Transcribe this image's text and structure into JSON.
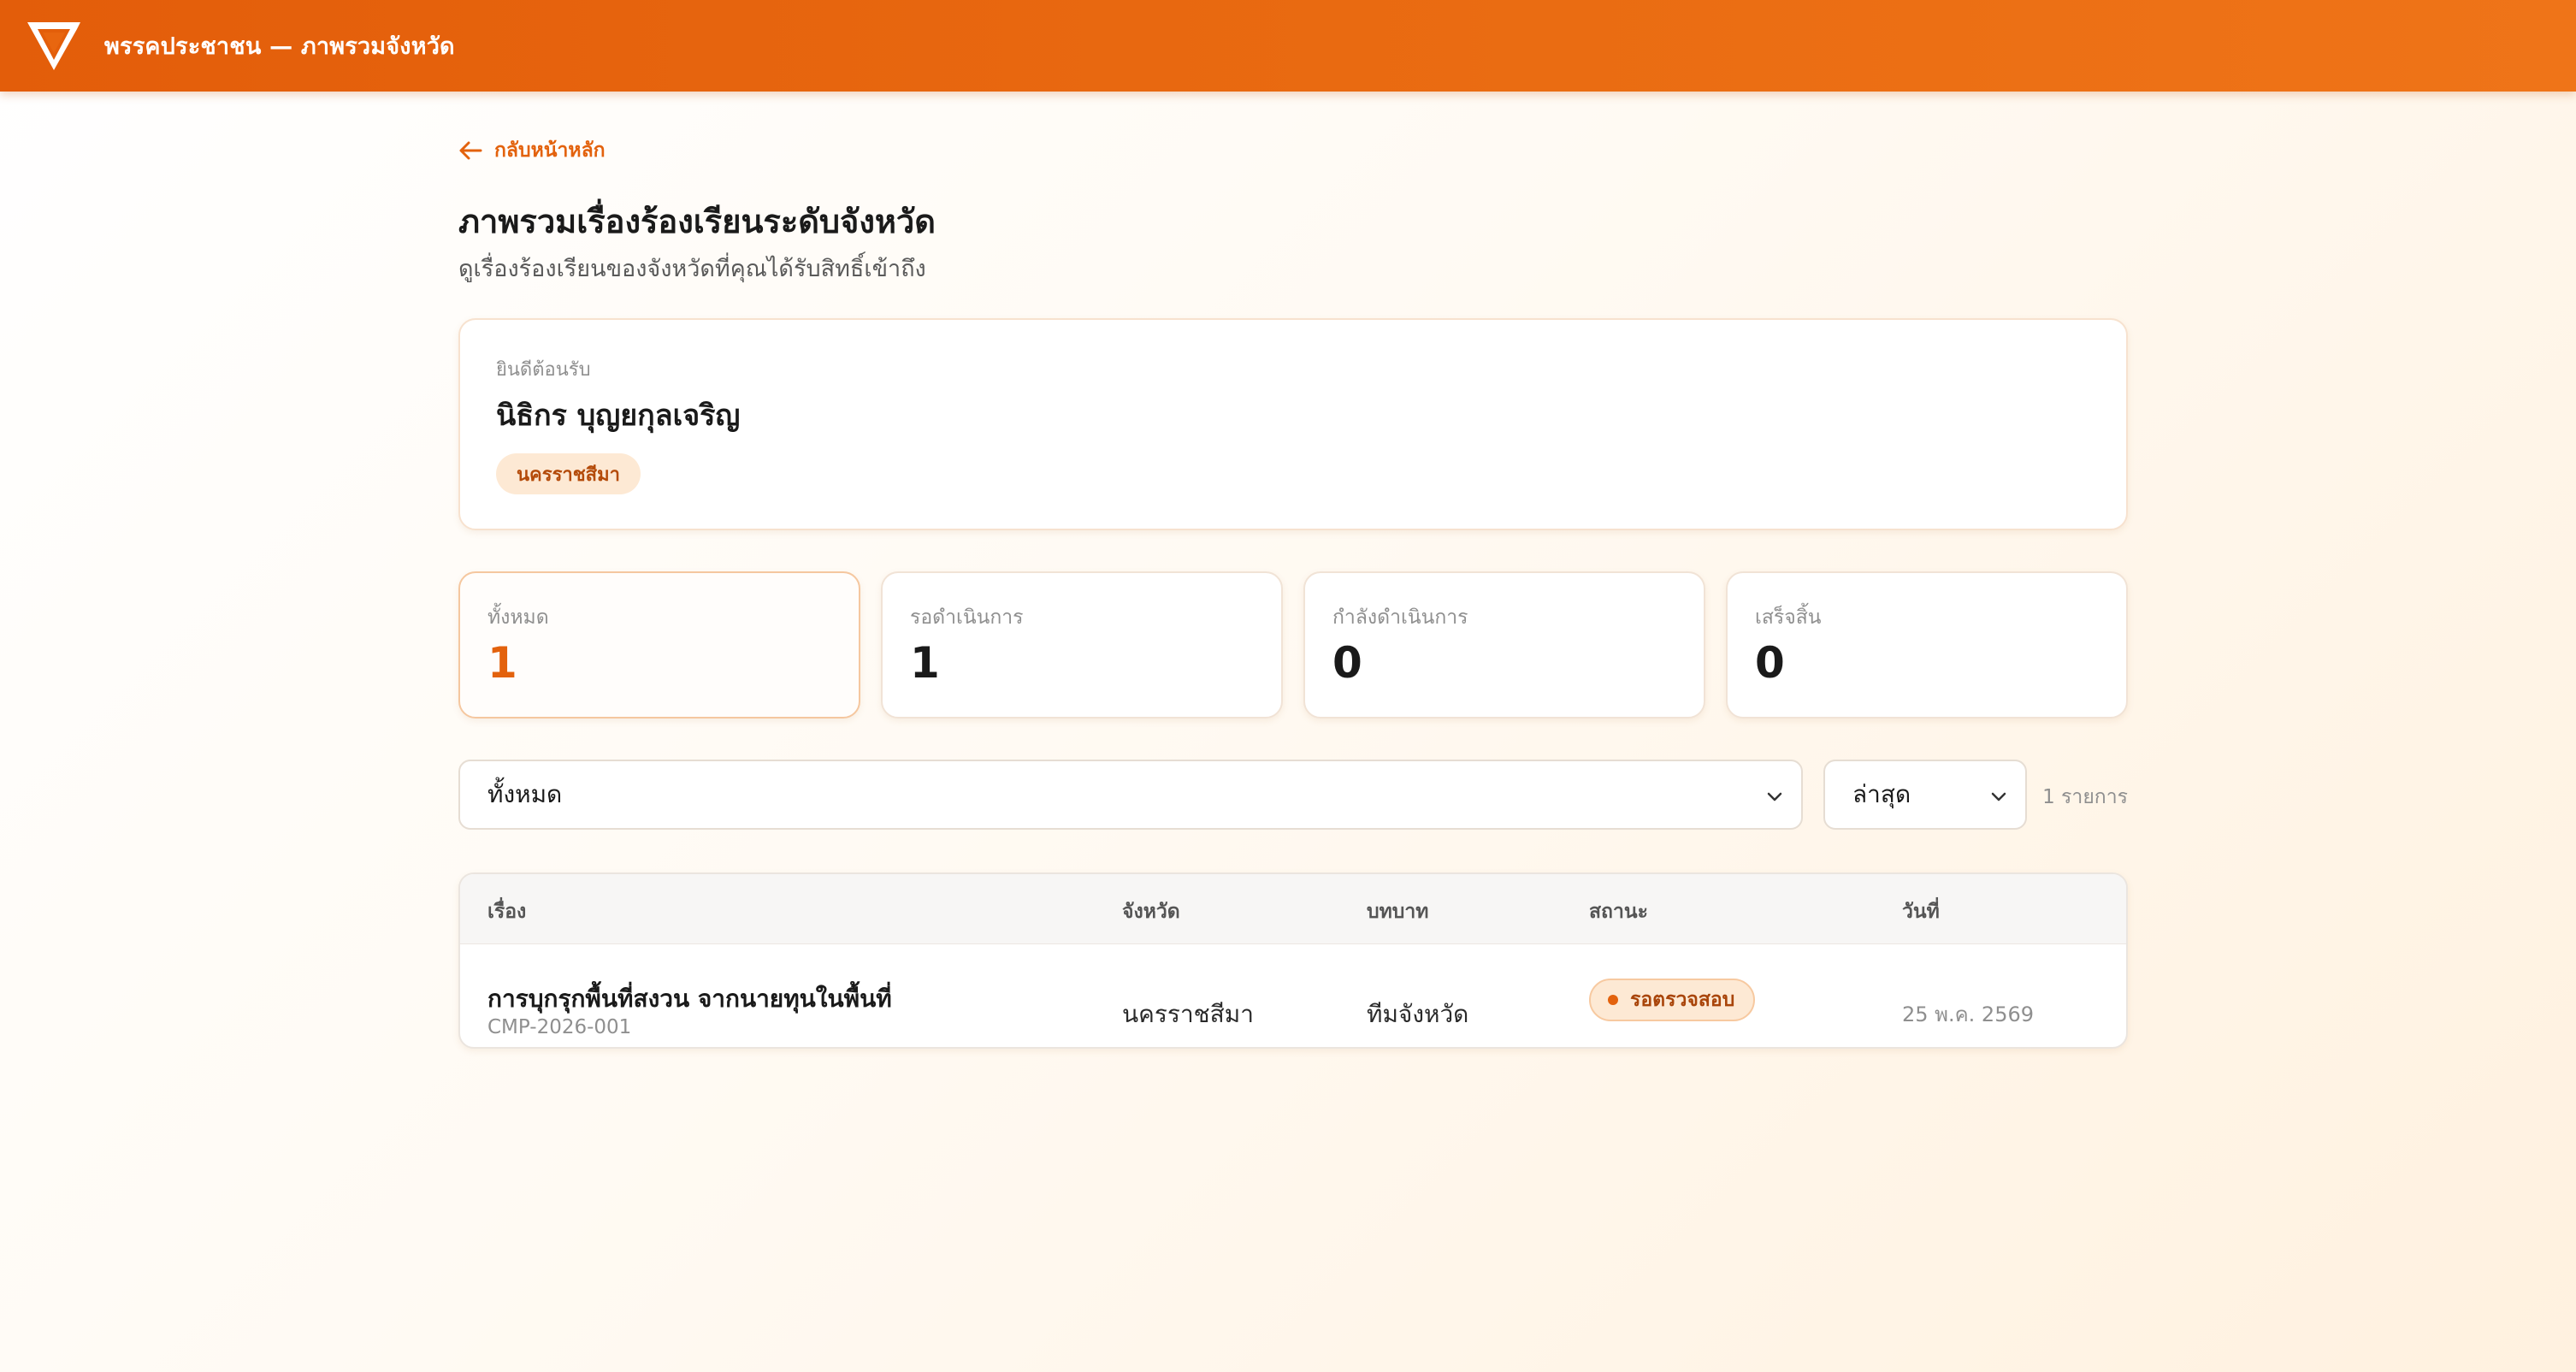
{
  "header": {
    "title": "พรรคประชาชน — ภาพรวมจังหวัด"
  },
  "back_link": {
    "label": "กลับหน้าหลัก"
  },
  "page": {
    "title": "ภาพรวมเรื่องร้องเรียนระดับจังหวัด",
    "subtitle": "ดูเรื่องร้องเรียนของจังหวัดที่คุณได้รับสิทธิ์เข้าถึง"
  },
  "welcome": {
    "label": "ยินดีต้อนรับ",
    "name": "นิธิกร บุญยกุลเจริญ",
    "province": "นครราชสีมา"
  },
  "stats": [
    {
      "label": "ทั้งหมด",
      "value": "1"
    },
    {
      "label": "รอดำเนินการ",
      "value": "1"
    },
    {
      "label": "กำลังดำเนินการ",
      "value": "0"
    },
    {
      "label": "เสร็จสิ้น",
      "value": "0"
    }
  ],
  "filters": {
    "status_value": "ทั้งหมด",
    "sort_value": "ล่าสุด",
    "count": "1 รายการ"
  },
  "table": {
    "headers": [
      "เรื่อง",
      "จังหวัด",
      "บทบาท",
      "สถานะ",
      "วันที่"
    ],
    "rows": [
      {
        "title": "การบุกรุกพื้นที่สงวน จากนายทุนในพื้นที่",
        "id": "CMP-2026-001",
        "province": "นครราชสีมา",
        "role": "ทีมจังหวัด",
        "status": "รอตรวจสอบ",
        "date": "25 พ.ค. 2569"
      }
    ]
  },
  "colors": {
    "brand": "#e3620d",
    "chip_bg": "#fde9d4",
    "chip_text": "#b44b0a"
  },
  "icons": {
    "logo": "party-logo-icon",
    "back": "arrow-left-icon",
    "chevron": "chevron-down-icon",
    "status": "status-dot-icon"
  }
}
